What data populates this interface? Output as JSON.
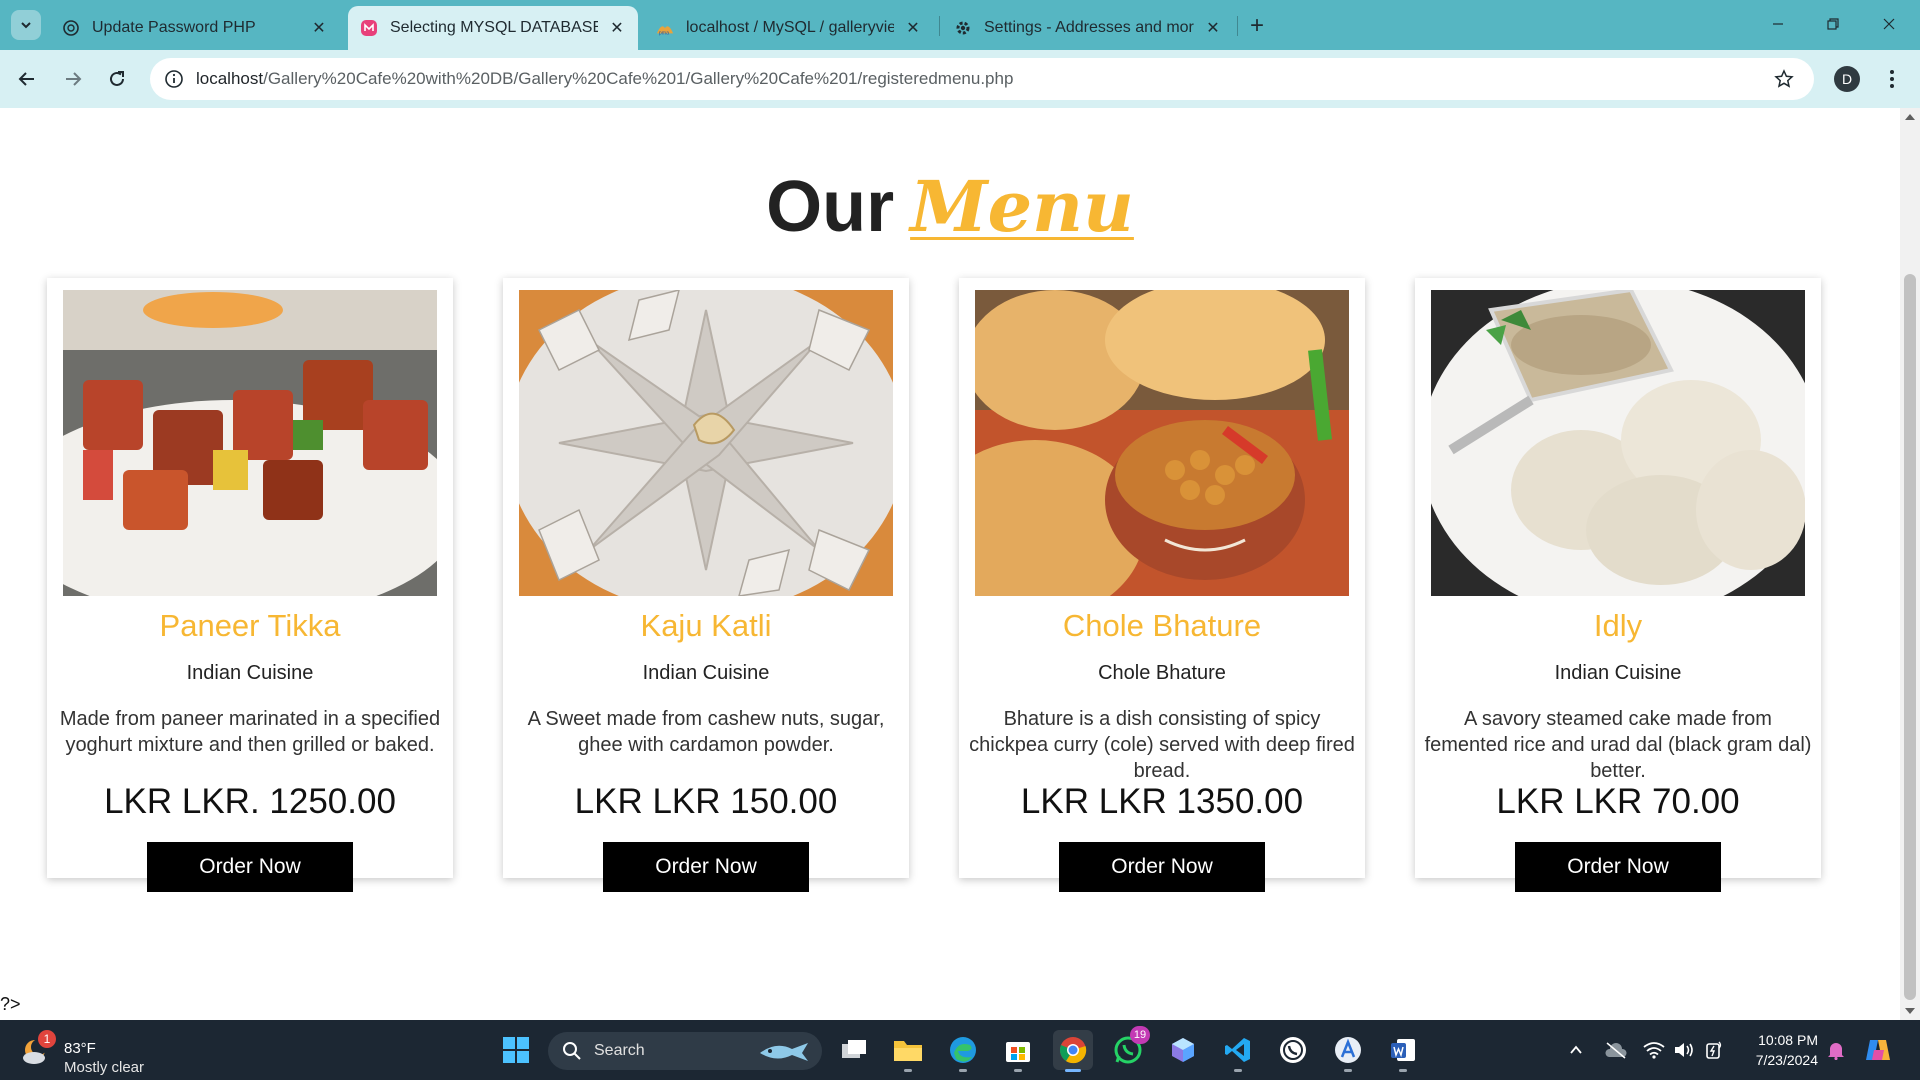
{
  "browser": {
    "tabs": [
      {
        "title": "Update Password PHP",
        "icon": "openai-icon",
        "active": false
      },
      {
        "title": "Selecting MYSQL DATABASE (Gi",
        "icon": "app-icon",
        "active": true
      },
      {
        "title": "localhost / MySQL / galleryview",
        "icon": "phpmyadmin-icon",
        "active": false
      },
      {
        "title": "Settings - Addresses and more",
        "icon": "gear-icon",
        "active": false
      }
    ],
    "close_glyph": "✕",
    "new_tab_glyph": "+",
    "url_host": "localhost",
    "url_path": "/Gallery%20Cafe%20with%20DB/Gallery%20Cafe%201/Gallery%20Cafe%201/registeredmenu.php",
    "profile_initial": "D"
  },
  "page": {
    "title_plain": "Our",
    "title_accent": "Menu",
    "accent_color": "#f7b733",
    "footer_text": "?>",
    "order_label": "Order Now",
    "items": [
      {
        "name": "Paneer Tikka",
        "cuisine": "Indian Cuisine",
        "description": "Made from paneer marinated in a specified yoghurt mixture and then grilled or baked.",
        "price": "LKR LKR. 1250.00"
      },
      {
        "name": "Kaju Katli",
        "cuisine": "Indian Cuisine",
        "description": "A Sweet made from cashew nuts, sugar, ghee with cardamon powder.",
        "price": "LKR LKR 150.00"
      },
      {
        "name": "Chole Bhature",
        "cuisine": "Chole Bhature",
        "description": "Bhature is a dish consisting of spicy chickpea curry (cole) served with deep fired bread.",
        "price": "LKR LKR 1350.00"
      },
      {
        "name": "Idly",
        "cuisine": "Indian Cuisine",
        "description": "A savory steamed cake made from femented rice and urad dal (black gram dal) better.",
        "price": "LKR LKR 70.00"
      }
    ]
  },
  "taskbar": {
    "weather_temp": "83°F",
    "weather_condition": "Mostly clear",
    "weather_badge": "1",
    "search_label": "Search",
    "whatsapp_badge": "19",
    "time": "10:08 PM",
    "date": "7/23/2024"
  }
}
